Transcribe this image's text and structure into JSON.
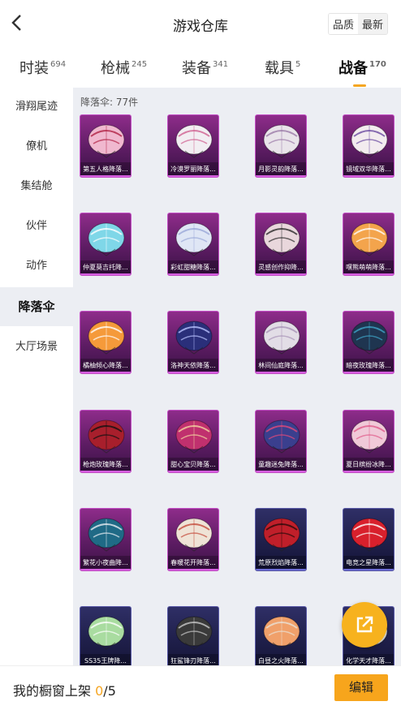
{
  "header": {
    "title": "游戏仓库",
    "sort_options": [
      "品质",
      "最新"
    ]
  },
  "tabs": [
    {
      "label": "时装",
      "count": "694"
    },
    {
      "label": "枪械",
      "count": "245"
    },
    {
      "label": "装备",
      "count": "341"
    },
    {
      "label": "载具",
      "count": "5"
    },
    {
      "label": "战备",
      "count": "170"
    }
  ],
  "sidebar": {
    "items": [
      "滑翔尾迹",
      "僚机",
      "集结舱",
      "伙伴",
      "动作",
      "降落伞",
      "大厅场景"
    ]
  },
  "content": {
    "count_label": "降落伞: 77件"
  },
  "items": [
    {
      "name": "第五人格降落...",
      "bg": "purple",
      "color": "#f0b8cf",
      "accent": "#b02244"
    },
    {
      "name": "冷漠罗丽降落...",
      "bg": "purple",
      "color": "#f2eef2",
      "accent": "#d06090"
    },
    {
      "name": "月影灵韵降落...",
      "bg": "purple",
      "color": "#e9e4ea",
      "accent": "#9b7aa8"
    },
    {
      "name": "镜域双华降落...",
      "bg": "purple",
      "color": "#f3ecef",
      "accent": "#6a4aa0"
    },
    {
      "name": "仲夏莫吉托降...",
      "bg": "purple",
      "color": "#7fd7e8",
      "accent": "#ffffff"
    },
    {
      "name": "彩虹甜糖降落...",
      "bg": "purple",
      "color": "#dfe6f5",
      "accent": "#9aa8d8"
    },
    {
      "name": "灵感创作抑降...",
      "bg": "purple",
      "color": "#e9d7dc",
      "accent": "#2a2a2a"
    },
    {
      "name": "嘿熊萌萌降落...",
      "bg": "purple",
      "color": "#f3a44c",
      "accent": "#ffffff"
    },
    {
      "name": "橘柚倾心降落...",
      "bg": "purple",
      "color": "#f59a3a",
      "accent": "#ffffff"
    },
    {
      "name": "洛神天依降落...",
      "bg": "purple",
      "color": "#2a2f7a",
      "accent": "#b9c2ff"
    },
    {
      "name": "林间仙庭降落...",
      "bg": "purple",
      "color": "#e2dde6",
      "accent": "#a893b6"
    },
    {
      "name": "暗夜玫瑰降落...",
      "bg": "purple",
      "color": "#1f3550",
      "accent": "#3fa5c8"
    },
    {
      "name": "枪炮玫瑰降落...",
      "bg": "purple",
      "color": "#a81f2c",
      "accent": "#111111"
    },
    {
      "name": "甜心宝贝降落...",
      "bg": "purple",
      "color": "#c0306e",
      "accent": "#f3d6a0"
    },
    {
      "name": "童趣迷兔降落...",
      "bg": "purple",
      "color": "#3a3f8e",
      "accent": "#e44a7a"
    },
    {
      "name": "夏日缤纷冰降...",
      "bg": "purple",
      "color": "#f0c9d8",
      "accent": "#e05a8a"
    },
    {
      "name": "繁花小夜曲降...",
      "bg": "purple",
      "color": "#1f6a86",
      "accent": "#e8eef2"
    },
    {
      "name": "春暖花开降落...",
      "bg": "purple",
      "color": "#efe3d6",
      "accent": "#c44a3a"
    },
    {
      "name": "荒原烈焰降落...",
      "bg": "navy",
      "color": "#c01f2a",
      "accent": "#2a0a0a"
    },
    {
      "name": "电竞之星降落...",
      "bg": "navy",
      "color": "#d8202c",
      "accent": "#ffffff"
    },
    {
      "name": "SS35王牌降...",
      "bg": "navy",
      "color": "#a9dca0",
      "accent": "#ffffff"
    },
    {
      "name": "狂鲨锋刃降落...",
      "bg": "navy",
      "color": "#3a3a3a",
      "accent": "#c9c9c9"
    },
    {
      "name": "白昼之火降落...",
      "bg": "navy",
      "color": "#f0a06a",
      "accent": "#e9e1d6"
    },
    {
      "name": "化学天才降落...",
      "bg": "navy",
      "color": "#e7e7e7",
      "accent": "#4a8fcf"
    }
  ],
  "footer": {
    "label": "我的橱窗上架",
    "count": "0",
    "total": "/5",
    "edit_label": "编辑"
  }
}
